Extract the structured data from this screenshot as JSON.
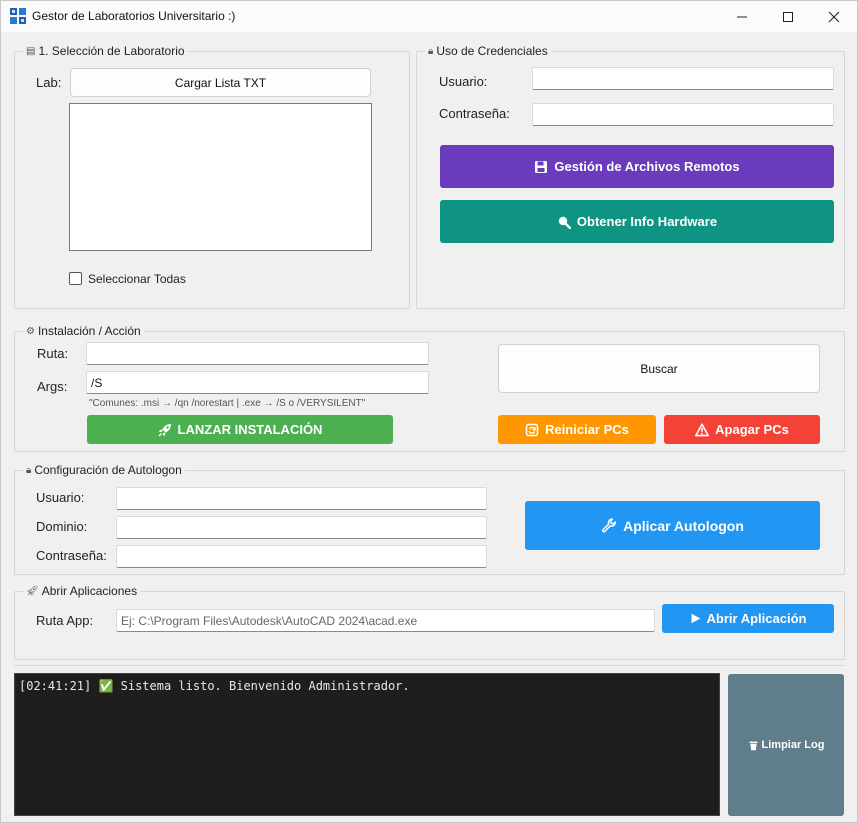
{
  "window": {
    "title": "Gestor de Laboratorios Universitario :)"
  },
  "lab_section": {
    "title": "1. Selección de Laboratorio",
    "lab_label": "Lab:",
    "load_button": "Cargar Lista TXT",
    "select_all_label": "Seleccionar Todas"
  },
  "credentials": {
    "title": "Uso de Credenciales",
    "user_label": "Usuario:",
    "user_value": "",
    "password_label": "Contraseña:",
    "password_value": "",
    "remote_files_button": "Gestión de Archivos Remotos",
    "hardware_button": "Obtener Info Hardware"
  },
  "install": {
    "title": "Instalación / Acción",
    "path_label": "Ruta:",
    "path_value": "",
    "args_label": "Args:",
    "args_value": "/S",
    "hint": "\"Comunes: .msi → /qn /norestart | .exe → /S o /VERYSILENT\"",
    "launch_button": "LANZAR INSTALACIÓN",
    "browse_button": "Buscar",
    "restart_button": "Reiniciar PCs",
    "shutdown_button": "Apagar PCs"
  },
  "autologon": {
    "title": "Configuración de Autologon",
    "user_label": "Usuario:",
    "domain_label": "Dominio:",
    "password_label": "Contraseña:",
    "apply_button": "Aplicar Autologon"
  },
  "apps": {
    "title": "Abrir Aplicaciones",
    "path_label": "Ruta App:",
    "path_placeholder": "Ej: C:\\Program Files\\Autodesk\\AutoCAD 2024\\acad.exe",
    "open_button": "Abrir Aplicación"
  },
  "log": {
    "lines": "[02:41:21] ✅ Sistema listo. Bienvenido Administrador.",
    "clear_button": "Limpiar Log"
  },
  "colors": {
    "purple": "#6b3bbd",
    "teal": "#0f9483",
    "green": "#4caf50",
    "orange": "#ff9800",
    "red": "#f44336",
    "blue": "#2196f3",
    "slate": "#607d8b"
  }
}
